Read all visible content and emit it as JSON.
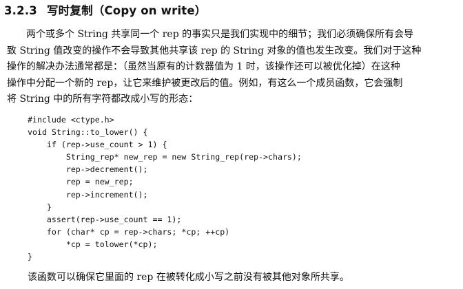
{
  "heading": {
    "number": "3.2.3",
    "title": "写时复制（Copy on write）"
  },
  "paragraph_lines": [
    "两个或多个 String 共享同一个 rep 的事实只是我们实现中的细节；我们必须确保所有会导",
    "致 String 值改变的操作不会导致其他共享该 rep 的 String 对象的值也发生改变。我们对于这种",
    "操作的解决办法通常都是：（虽然当原有的计数器值为 1 时，该操作还可以被优化掉）在这种",
    "操作中分配一个新的 rep，让它来维护被更改后的值。例如，有这么一个成员函数，它会强制",
    "将 String 中的所有字符都改成小写的形态："
  ],
  "code_lines": [
    "#include <ctype.h>",
    "void String::to_lower() {",
    "    if (rep->use_count > 1) {",
    "        String_rep* new_rep = new String_rep(rep->chars);",
    "        rep->decrement();",
    "        rep = new_rep;",
    "        rep->increment();",
    "    }",
    "    assert(rep->use_count == 1);",
    "    for (char* cp = rep->chars; *cp; ++cp)",
    "        *cp = tolower(*cp);",
    "}"
  ],
  "closing_text": "该函数可以确保它里面的 rep 在被转化成小写之前没有被其他对象所共享。"
}
